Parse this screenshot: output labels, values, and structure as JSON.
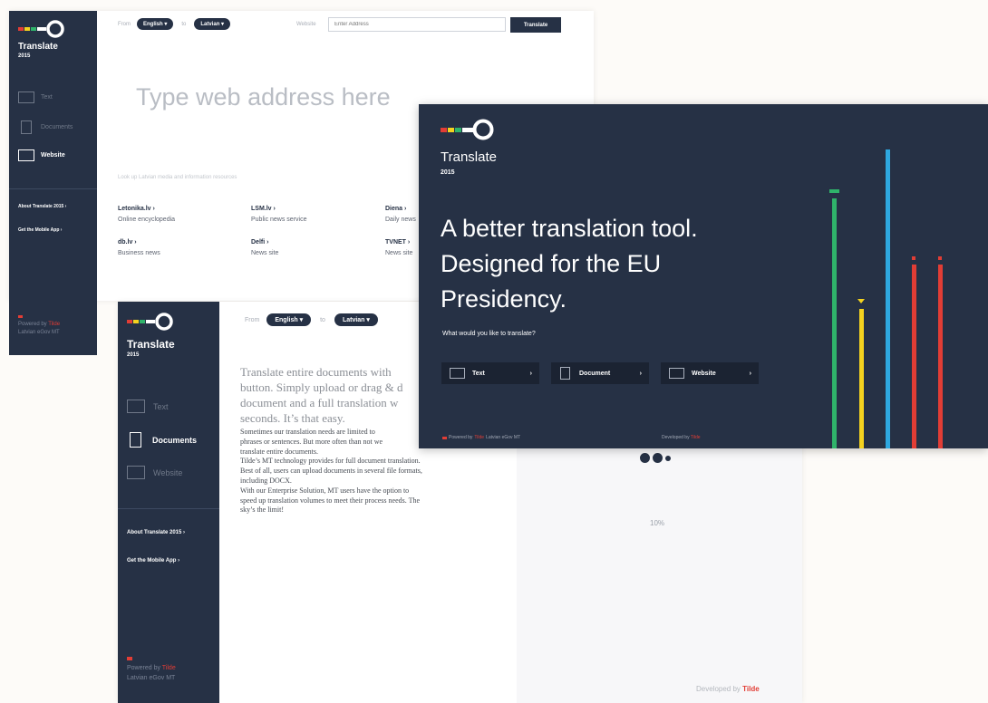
{
  "brand": {
    "name": "Translate",
    "year": "2015"
  },
  "screen_website": {
    "from_label": "From",
    "from_lang": "English",
    "to_label": "to",
    "to_lang": "Latvian",
    "website_label": "Website",
    "website_placeholder": "Enter Address",
    "translate_button": "Translate",
    "big_placeholder": "Type web address here",
    "hint": "Look up Latvian media and information resources",
    "nav": [
      {
        "label": "Text"
      },
      {
        "label": "Documents"
      },
      {
        "label": "Website"
      }
    ],
    "links_menu": [
      {
        "label": "About Translate 2015"
      },
      {
        "label": "Get the Mobile App"
      }
    ],
    "resources": [
      {
        "title": "Letonika.lv",
        "sub": "Online encyclopedia"
      },
      {
        "title": "LSM.lv",
        "sub": "Public news service"
      },
      {
        "title": "Diena",
        "sub": "Daily news"
      },
      {
        "title": "db.lv",
        "sub": "Business news"
      },
      {
        "title": "Delfi",
        "sub": "News site"
      },
      {
        "title": "TVNET",
        "sub": "News site"
      }
    ],
    "powered_prefix": "Powered by",
    "powered_brand": "Tilde",
    "powered_line2": "Latvian eGov MT"
  },
  "screen_documents": {
    "from_label": "From",
    "from_lang": "English",
    "to_label": "to",
    "to_lang": "Latvian",
    "nav": [
      {
        "label": "Text"
      },
      {
        "label": "Documents"
      },
      {
        "label": "Website"
      }
    ],
    "links_menu": [
      {
        "label": "About Translate 2015"
      },
      {
        "label": "Get the Mobile App"
      }
    ],
    "intro_lines": [
      "Translate entire documents with",
      "button. Simply upload or drag & d",
      "document and a full translation w",
      "seconds. It’s that easy."
    ],
    "body_lines": [
      "Sometimes our translation needs are limited to",
      "phrases or sentences. But more often than not we",
      "translate entire documents.",
      "Tilde’s MT technology provides for full document translation.",
      "Best of all, users can upload documents in several file formats,",
      "including DOCX.",
      "With our Enterprise Solution, MT users have the option to",
      "speed up translation volumes to meet their process needs. The",
      "sky’s the limit!"
    ],
    "progress_text": "10%",
    "progress_value": 0.1,
    "developed_prefix": "Developed by",
    "developed_brand": "Tilde",
    "powered_prefix": "Powered by",
    "powered_brand": "Tilde",
    "powered_line2": "Latvian eGov MT"
  },
  "screen_home": {
    "headline": [
      "A better translation tool.",
      "Designed for the EU",
      "Presidency."
    ],
    "question": "What would you like to translate?",
    "buttons": [
      {
        "label": "Text"
      },
      {
        "label": "Document"
      },
      {
        "label": "Website"
      }
    ],
    "powered_prefix": "Powered by",
    "powered_brand": "Tilde",
    "powered_line2": "Latvian eGov MT",
    "developed_prefix": "Developed by",
    "developed_brand": "Tilde"
  },
  "colors": {
    "navy": "#263145",
    "green": "#2fb36a",
    "yellow": "#f4d21f",
    "blue": "#2ea7df",
    "red": "#e23d35",
    "tilde_red": "#e23d35"
  }
}
